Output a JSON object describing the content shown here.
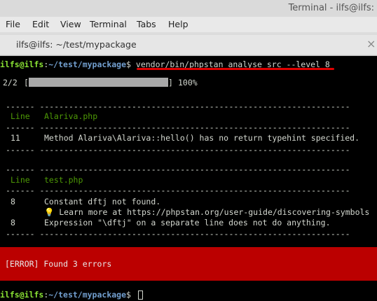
{
  "window": {
    "title": "Terminal - ilfs@ilfs:"
  },
  "menu": [
    "File",
    "Edit",
    "View",
    "Terminal",
    "Tabs",
    "Help"
  ],
  "tab": {
    "label": "ilfs@ilfs: ~/test/mypackage",
    "close": "×"
  },
  "prompt": {
    "user": "ilfs@ilfs",
    "sep": ":",
    "path": "~/test/mypackage",
    "symbol": "$"
  },
  "command": "vendor/bin/phpstan analyse src --level 8",
  "progress": {
    "count": "2/2",
    "percent": "100%",
    "value": 1.0
  },
  "divider": "------ ----------------------------------------------------------------",
  "files": [
    {
      "header_line": "Line",
      "file": "Alariva.php",
      "rows": [
        {
          "line": "11",
          "message": "Method Alariva\\Alariva::hello() has no return typehint specified."
        }
      ]
    },
    {
      "header_line": "Line",
      "file": "test.php",
      "rows": [
        {
          "line": "8",
          "message": "Constant dftj not found."
        },
        {
          "line": "",
          "message": "💡 Learn more at https://phpstan.org/user-guide/discovering-symbols"
        },
        {
          "line": "8",
          "message": "Expression \"\\dftj\" on a separate line does not do anything."
        }
      ]
    }
  ],
  "error": "[ERROR] Found 3 errors",
  "colors": {
    "accent_red": "#bb0000",
    "prompt_green": "#8ae234",
    "path_blue": "#729fcf",
    "underline": "#e00000"
  }
}
